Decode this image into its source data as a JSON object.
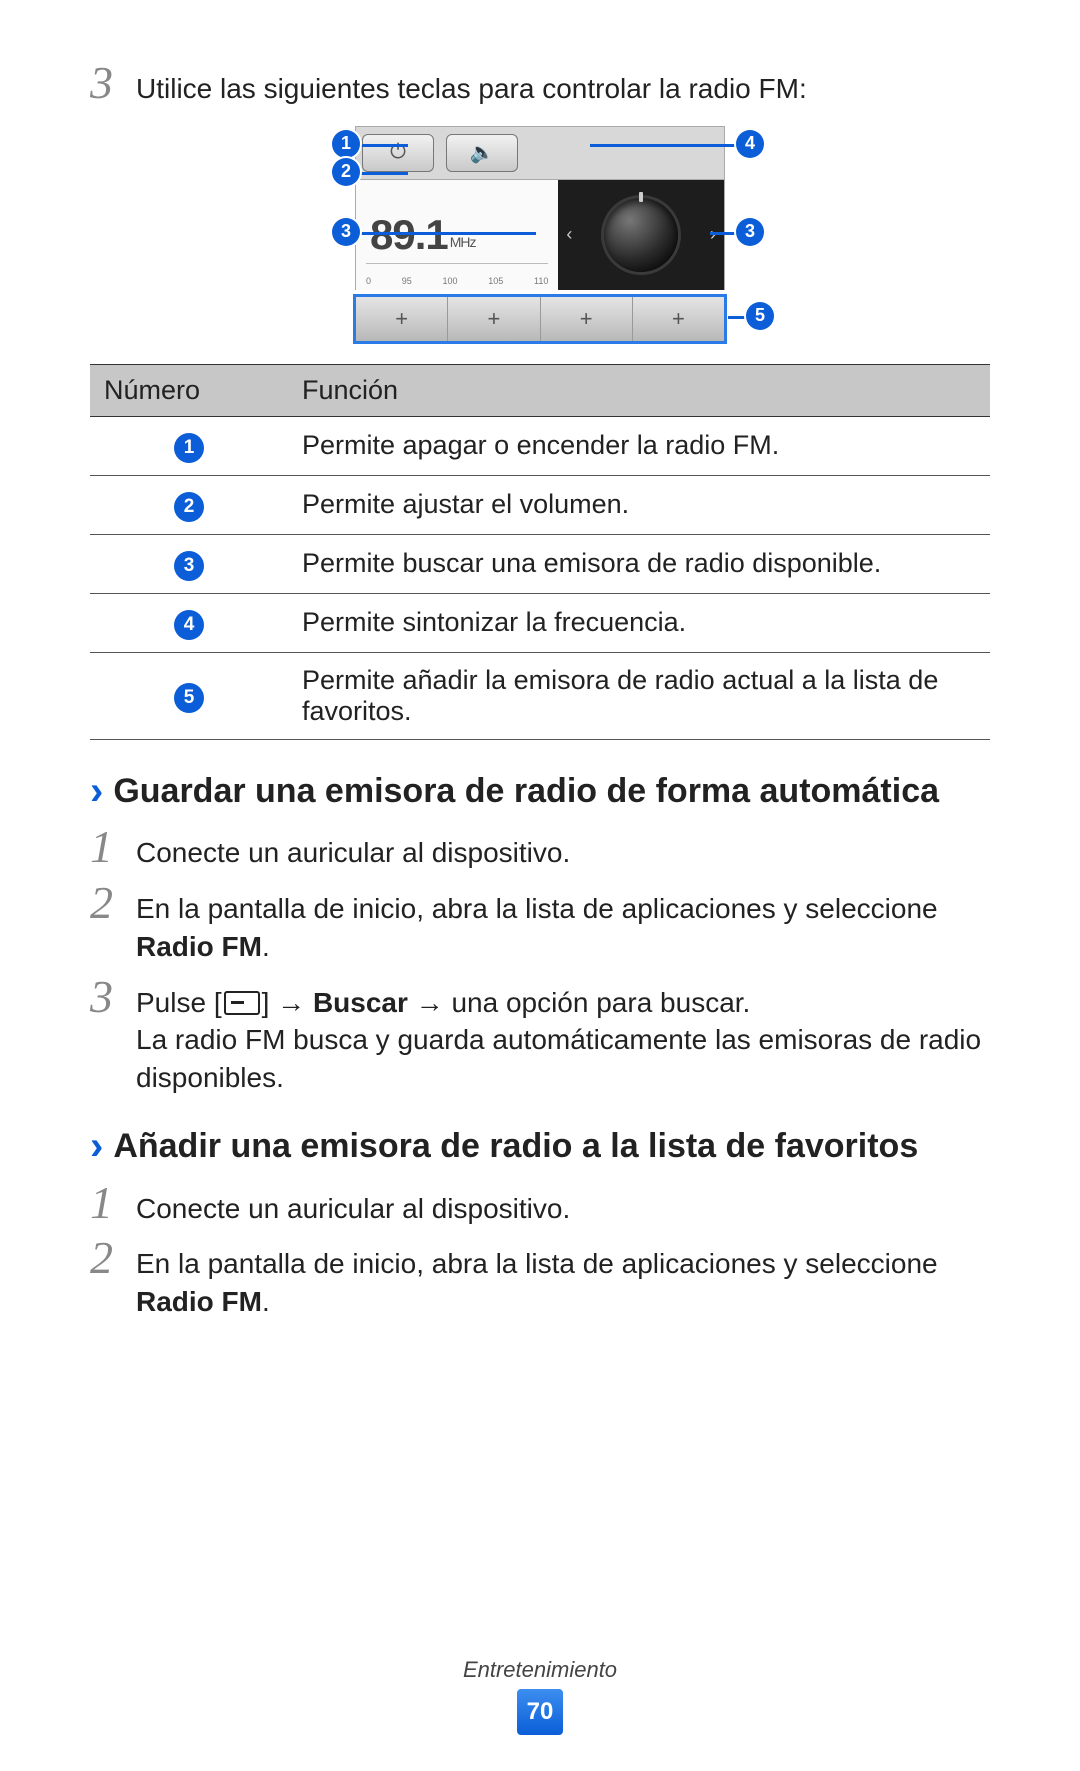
{
  "step3": {
    "num": "3",
    "text": "Utilice las siguientes teclas para controlar la radio FM:"
  },
  "radio": {
    "frequency": "89.1",
    "unit": "MHz",
    "ruler": [
      "0",
      "95",
      "100",
      "105",
      "110"
    ],
    "fav_plus": "+"
  },
  "callouts": {
    "n1": "1",
    "n2": "2",
    "n3": "3",
    "n4": "4",
    "n5": "5"
  },
  "table": {
    "head_num": "Número",
    "head_func": "Función",
    "rows": [
      {
        "n": "1",
        "func": "Permite apagar o encender la radio FM."
      },
      {
        "n": "2",
        "func": "Permite ajustar el volumen."
      },
      {
        "n": "3",
        "func": "Permite buscar una emisora de radio disponible."
      },
      {
        "n": "4",
        "func": "Permite sintonizar la frecuencia."
      },
      {
        "n": "5",
        "func": "Permite añadir la emisora de radio actual a la lista de favoritos."
      }
    ]
  },
  "sectionA": {
    "title": "Guardar una emisora de radio de forma automática",
    "steps": {
      "s1": {
        "num": "1",
        "text": "Conecte un auricular al dispositivo."
      },
      "s2": {
        "num": "2",
        "pre": "En la pantalla de inicio, abra la lista de aplicaciones y seleccione ",
        "bold": "Radio FM",
        "post": "."
      },
      "s3": {
        "num": "3",
        "pre": "Pulse [",
        "mid1": "] → ",
        "bold": "Buscar",
        "mid2": " → una opción para buscar.",
        "line2": "La radio FM busca y guarda automáticamente las emisoras de radio disponibles."
      }
    }
  },
  "sectionB": {
    "title": "Añadir una emisora de radio a la lista de favoritos",
    "steps": {
      "s1": {
        "num": "1",
        "text": "Conecte un auricular al dispositivo."
      },
      "s2": {
        "num": "2",
        "pre": "En la pantalla de inicio, abra la lista de aplicaciones y seleccione ",
        "bold": "Radio FM",
        "post": "."
      }
    }
  },
  "footer": {
    "category": "Entretenimiento",
    "page": "70"
  }
}
